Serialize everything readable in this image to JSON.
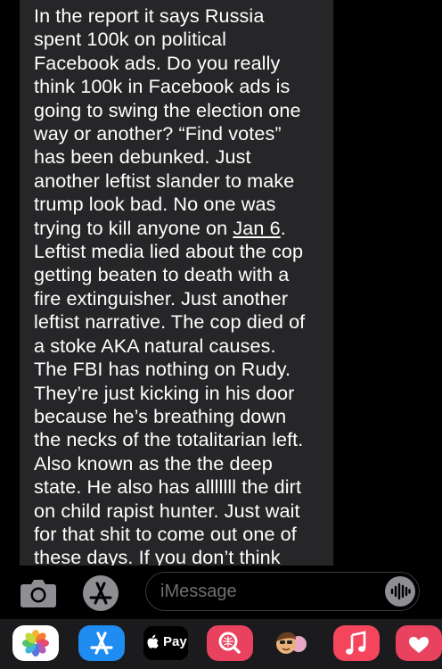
{
  "message": {
    "text": "In the report it says Russia\nspent 100k on political\nFacebook ads. Do you really\nthink 100k in Facebook ads is\ngoing to swing the election one\nway or another? “Find votes”\nhas been debunked. Just\nanother leftist slander to make\ntrump look bad. No one was\ntrying to kill anyone on ",
    "link": "Jan 6",
    "text_after": ".\nLeftist media lied about the cop\ngetting beaten to death with a\nfire extinguisher. Just another\nleftist narrative. The cop died of\na stoke AKA natural causes.\nThe FBI has nothing on Rudy.\nThey’re just kicking in his door\nbecause he’s breathing down\nthe necks of the totalitarian left.\nAlso known as the the deep\nstate. He also has alllllll the dirt\non child rapist hunter. Just wait\nfor that shit to come out one of\nthese days. If you don’t think"
  },
  "composer": {
    "placeholder": "iMessage"
  },
  "app_drawer": {
    "apps": [
      {
        "name": "photos-app-icon"
      },
      {
        "name": "app-store-icon"
      },
      {
        "name": "apple-pay-icon",
        "label": "Pay"
      },
      {
        "name": "search-images-icon"
      },
      {
        "name": "memoji-icon"
      },
      {
        "name": "music-icon"
      },
      {
        "name": "digital-touch-icon"
      }
    ]
  },
  "colors": {
    "background": "#000000",
    "bubble": "#262628",
    "placeholder": "#6e6e73",
    "app_store_blue": "#1e8cf0",
    "music_red": "#f5455c",
    "search_red": "#e8425f"
  }
}
